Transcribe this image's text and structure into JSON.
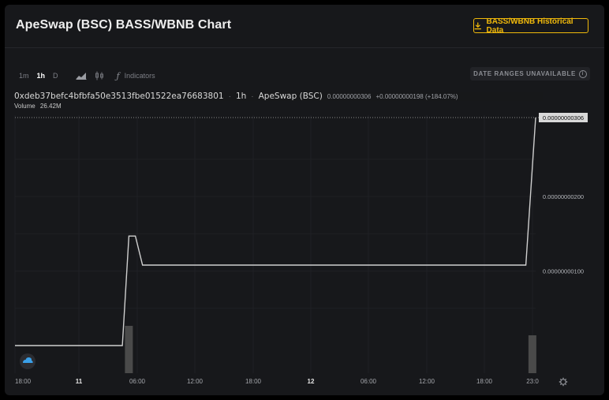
{
  "header": {
    "title": "ApeSwap (BSC) BASS/WBNB Chart",
    "historical_button": "BASS/WBNB Historical Data"
  },
  "toolbar": {
    "timeframes": [
      "1m",
      "1h",
      "D"
    ],
    "active_timeframe": "1h",
    "indicators_label": "Indicators",
    "date_ranges_label": "DATE RANGES UNAVAILABLE"
  },
  "legend": {
    "symbol": "0xdeb37befc4bfbfa50e3513fbe01522ea76683801",
    "interval": "1h",
    "exchange": "ApeSwap (BSC)",
    "last_value": "0.00000000306",
    "change": "+0.00000000198 (+184.07%)",
    "volume_label": "Volume",
    "volume_value": "26.42M"
  },
  "colors": {
    "accent": "#f0b90b",
    "line": "#cfcfcf",
    "volume_bar": "#4a4a4a",
    "background": "#17181b"
  },
  "chart_data": {
    "type": "line",
    "price_axis": {
      "ticks": [
        "0.00000000306",
        "0.00000000200",
        "0.00000000100"
      ],
      "tick_values": [
        3.06,
        2.0,
        1.0
      ],
      "unit_scale": "1e-9",
      "last_price_label": "0.00000000306"
    },
    "time_axis": {
      "ticks": [
        "18:00",
        "11",
        "06:00",
        "12:00",
        "18:00",
        "12",
        "06:00",
        "12:00",
        "18:00",
        "23:0"
      ],
      "bold_ticks": [
        "11",
        "12"
      ]
    },
    "series": [
      {
        "x": [
          0,
          16.5,
          17.5,
          18.5,
          19.6,
          78.5,
          80.0
        ],
        "y": [
          0.0,
          0.0,
          1.47,
          1.47,
          1.08,
          1.08,
          3.06
        ]
      }
    ],
    "volume": [
      {
        "x": 17.5,
        "value": 0.6
      },
      {
        "x": 79.5,
        "value": 0.48
      }
    ],
    "grid": true
  }
}
